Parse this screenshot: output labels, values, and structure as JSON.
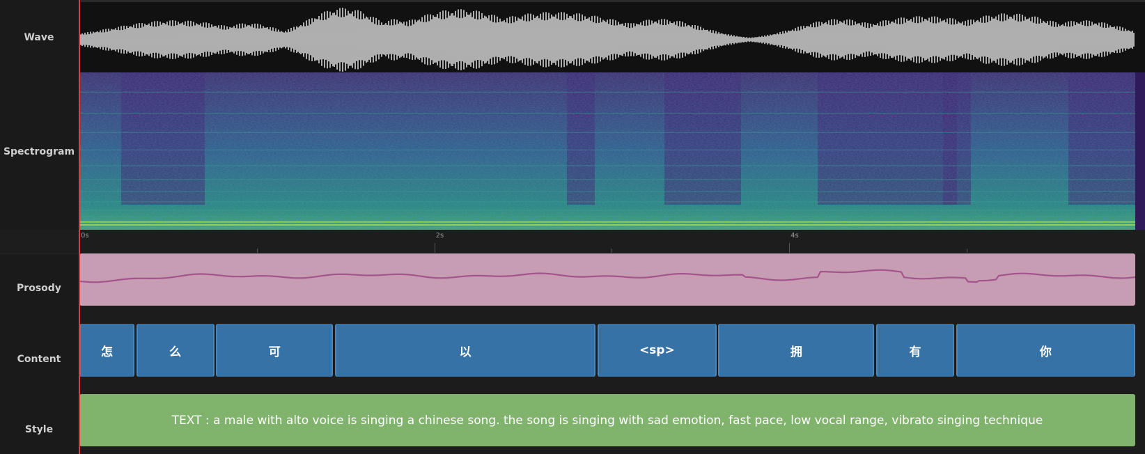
{
  "tracks": {
    "wave": "Wave",
    "spectrogram": "Spectrogram",
    "prosody": "Prosody",
    "content": "Content",
    "style": "Style"
  },
  "ruler": {
    "labels": [
      "0s",
      "2s",
      "4s"
    ],
    "label_times": [
      0,
      2,
      4
    ],
    "minor_times": [
      1,
      3,
      5
    ],
    "duration_s": 5.95
  },
  "content": {
    "segments": [
      {
        "text": "怎",
        "start": 0.0,
        "end": 0.31
      },
      {
        "text": "么",
        "start": 0.32,
        "end": 0.76
      },
      {
        "text": "可",
        "start": 0.77,
        "end": 1.43
      },
      {
        "text": "以",
        "start": 1.44,
        "end": 2.91
      },
      {
        "text": "<sp>",
        "start": 2.92,
        "end": 3.59
      },
      {
        "text": "拥",
        "start": 3.6,
        "end": 4.48
      },
      {
        "text": "有",
        "start": 4.49,
        "end": 4.93
      },
      {
        "text": "你",
        "start": 4.94,
        "end": 5.95
      }
    ]
  },
  "style": {
    "text": "TEXT : a male with alto voice is singing a chinese song. the song is singing with sad emotion, fast pace, low vocal range, vibrato singing technique"
  },
  "colors": {
    "playhead": "#e23b3b",
    "prosody_fill": "#c79db3",
    "prosody_line": "#a5538c",
    "content_fill": "#3672a6",
    "style_fill": "#80b46d",
    "waveform": "#f2f2f2"
  }
}
